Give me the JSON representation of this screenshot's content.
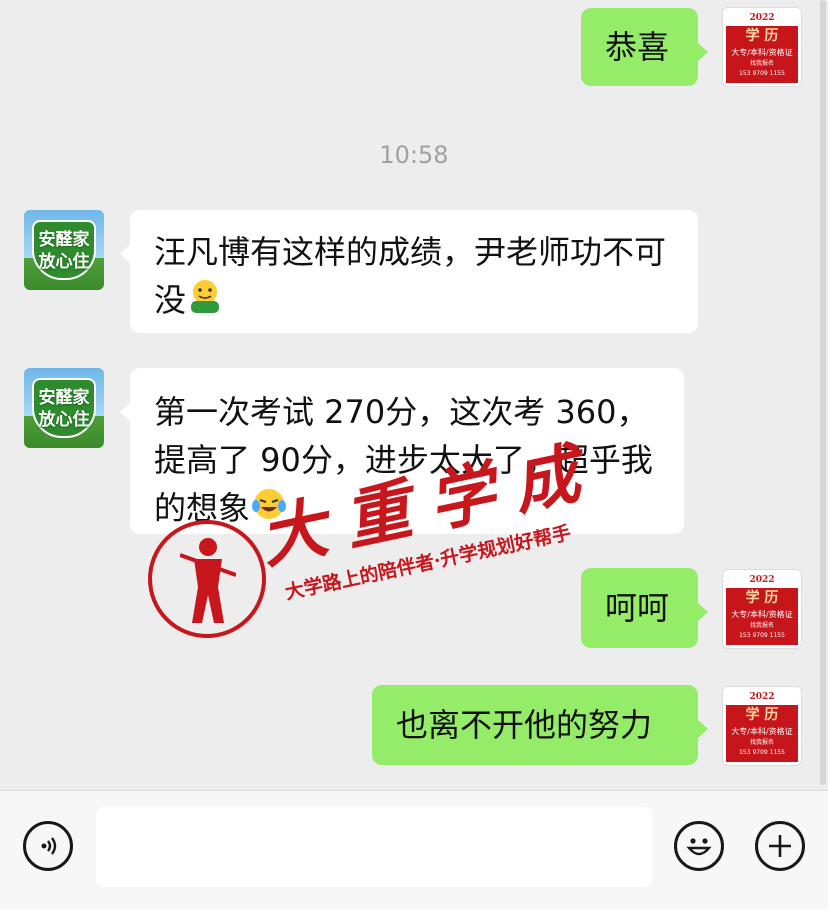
{
  "messages": [
    {
      "side": "me",
      "text": "恭喜"
    },
    {
      "side": "other",
      "text": "汪凡博有这样的成绩，尹老师功不可没",
      "emoji": "hugging-face"
    },
    {
      "side": "other",
      "text": "第一次考试 270分，这次考 360，提高了 90分，进步太大了，超乎我的想象",
      "emoji": "crying-laughing-face"
    },
    {
      "side": "me",
      "text": "呵呵"
    },
    {
      "side": "me",
      "text": "也离不开他的努力"
    }
  ],
  "timestamp": "10:58",
  "avatar_me": {
    "year": "2022",
    "title": "学 历",
    "subtitle": "大专/本科/资格证",
    "cta": "找我报名",
    "phone": "153 9709 1155"
  },
  "avatar_other": {
    "line1": "安醛家",
    "line2": "放心住"
  },
  "watermark": {
    "title": "大重学成",
    "subtitle": "大学路上的陪伴者·升学规划好帮手"
  },
  "bottom_bar": {
    "input_value": "",
    "icons": [
      "voice-icon",
      "emoji-icon",
      "plus-icon"
    ]
  },
  "colors": {
    "my_bubble": "#95ec69",
    "other_bubble": "#ffffff",
    "background": "#ededed",
    "watermark": "#c8161d"
  }
}
